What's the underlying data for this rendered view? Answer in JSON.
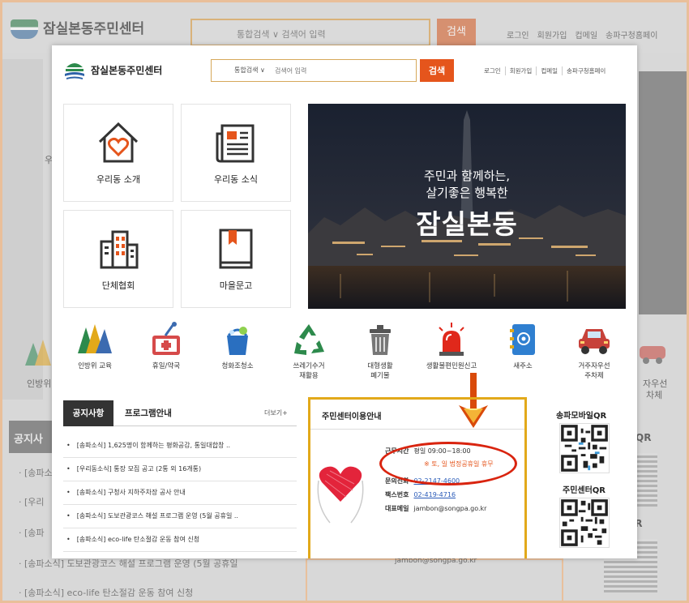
{
  "background": {
    "site_name": "잠실본동주민센터",
    "search_placeholder": "통합검색 ∨  검색어 입력",
    "search_button": "검색",
    "menu": [
      "로그인",
      "회원가입",
      "컵메일",
      "송파구청홈페이"
    ],
    "notice_tab": "공지사",
    "list": [
      "· [송파소식",
      "· [우리",
      "· [송파",
      "· [송파소식] 도보관광코스 해설 프로그램 운영 (5월 공휴일",
      "· [송파소식] eco-life 탄소절감 운동 참여 신청"
    ],
    "side_labels": [
      "인방위",
      "우",
      "자우선",
      "차체"
    ],
    "qr_labels": [
      "일QR",
      "QR"
    ],
    "email": "jambon@songpa.go.kr"
  },
  "header": {
    "site_name": "잠실본동주민센터",
    "search_scope": "통합검색 ∨",
    "search_placeholder": "검색어 입력",
    "search_button": "검색",
    "menu": [
      "로그인",
      "회원가입",
      "컵메일",
      "송파구청홈페이"
    ]
  },
  "tiles": [
    {
      "label": "우리동 소개",
      "icon": "house-heart-icon"
    },
    {
      "label": "우리동 소식",
      "icon": "newspaper-icon"
    },
    {
      "label": "단체협회",
      "icon": "building-icon"
    },
    {
      "label": "마을문고",
      "icon": "book-icon"
    }
  ],
  "hero": {
    "line1": "주민과 함께하는,",
    "line2": "살기좋은 행복한",
    "title": "잠실본동"
  },
  "services": [
    {
      "label": "인방위 교육",
      "icon": "mountains-icon"
    },
    {
      "label": "휴일/약국",
      "icon": "pharmacy-icon"
    },
    {
      "label": "청화조청소",
      "icon": "cleaning-bucket-icon"
    },
    {
      "label": "쓰레기수거\n재활용",
      "icon": "recycle-icon"
    },
    {
      "label": "대형생활\n폐기물",
      "icon": "trash-bin-icon"
    },
    {
      "label": "생활불편민원신고",
      "icon": "siren-icon"
    },
    {
      "label": "새주소",
      "icon": "address-book-icon"
    },
    {
      "label": "거주자우선\n주차제",
      "icon": "car-icon"
    }
  ],
  "notice": {
    "tab_active": "공지사항",
    "tab_other": "프로그램안내",
    "more": "더보기+",
    "items": [
      "[송파소식] 1,625명이 함께하는 평화공감, 통일대합창 ..",
      "[우리동소식] 통장 모집 공고 (2통 외 16개통)",
      "[송파소식] 구청사 지하주차장 공사 안내",
      "[송파소식] 도보관광코스 해설 프로그램 운영 (5월 공휴일 ..",
      "[송파소식] eco-life 탄소절감 운동 참여 신청"
    ]
  },
  "info": {
    "title": "주민센터이용안내",
    "hours_label": "근무시간",
    "hours_value": "평일 09:00~18:00",
    "hours_note": "※ 토, 일 법정공휴일 휴무",
    "phone_label": "문의전화",
    "phone_value": "02-2147-4600",
    "fax_label": "팩스번호",
    "fax_value": "02-419-4716",
    "email_label": "대표메일",
    "email_value": "jambon@songpa.go.kr"
  },
  "qr": {
    "mobile": "송파모바일QR",
    "center": "주민센터QR"
  },
  "colors": {
    "accent": "#e5551c",
    "highlight_ellipse": "#d9240f",
    "highlight_box": "#e2a91a",
    "arrow": "#d94a0a"
  }
}
